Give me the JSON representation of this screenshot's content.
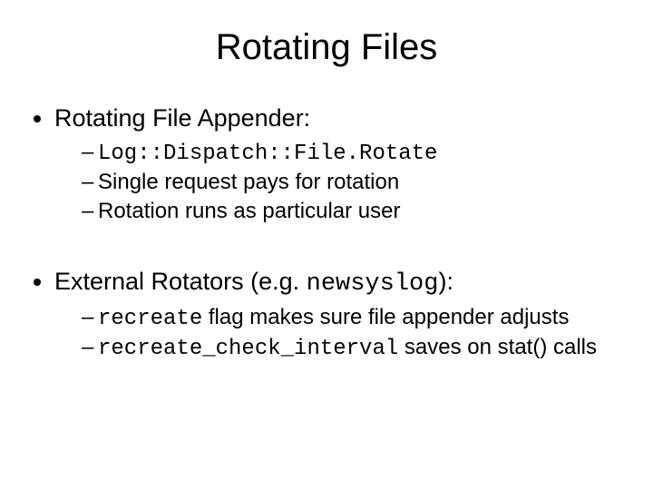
{
  "title": "Rotating Files",
  "bullets": [
    {
      "label": "Rotating File Appender:",
      "sub": [
        {
          "code": "Log::Dispatch::File.Rotate"
        },
        {
          "text": "Single request pays for rotation"
        },
        {
          "text": "Rotation runs as particular user"
        }
      ]
    },
    {
      "label_pre": "External Rotators (e.g. ",
      "label_code": "newsyslog",
      "label_post": "):",
      "sub": [
        {
          "code_pre": "recreate",
          "text_post": " flag makes sure file appender adjusts"
        },
        {
          "code_pre": "recreate_check_interval",
          "text_post": " saves on stat() calls"
        }
      ]
    }
  ]
}
